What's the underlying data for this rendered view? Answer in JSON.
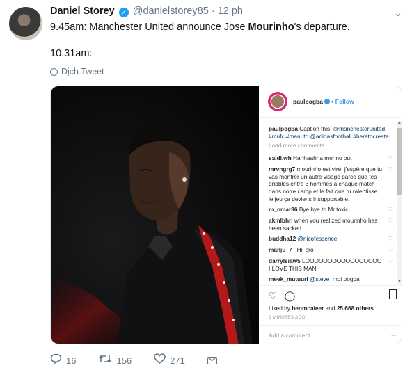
{
  "tweet": {
    "display_name": "Daniel Storey",
    "handle": "@danielstorey85",
    "separator": "·",
    "time": "12 ph",
    "text_line1_a": "9.45am: Manchester United announce Jose ",
    "text_line1_bold": "Mourinho",
    "text_line1_b": "'s departure.",
    "text_line2": "10.31am:",
    "translate_label": "Dịch Tweet"
  },
  "instagram": {
    "username": "paulpogba",
    "dot": "•",
    "follow": "Follow",
    "caption_user": "paulpogba",
    "caption_text": " Caption this!",
    "caption_tags": "@manchesterunited #mufc #manutd @adidasfootball #heretocreate",
    "load_more": "Load more comments",
    "comments": [
      {
        "user": "saidi.wh",
        "text": " Hahhaahha morino out",
        "mention": ""
      },
      {
        "user": "mrvngrg7",
        "text": " mourinho est viré, j'espère que tu vas montrer un autre visage parce que tes dribbles entre 3 hommes à chaque match dans notre camp et le fait que tu ralentisse le jeu ça deviens insupportable.",
        "mention": ""
      },
      {
        "user": "m_omar96",
        "text": " Bye bye to Mr toxic",
        "mention": ""
      },
      {
        "user": "akmlbhri",
        "text": " when you realized mourinho has been sacked",
        "mention": ""
      },
      {
        "user": "buddha12",
        "text": " ",
        "mention": "@nicofessence"
      },
      {
        "user": "manju_7_",
        "text": " Hii bro",
        "mention": ""
      },
      {
        "user": "darrylsiaw5",
        "text": " LOOOOOOOOOOOOOOOOO I LOVE THIS MAN",
        "mention": ""
      },
      {
        "user": "meek_mutuuri",
        "text": " pogba",
        "mention": "@steve_moi"
      }
    ],
    "likes_prefix": "Liked by ",
    "likes_user": "benmcaleer",
    "likes_mid": " and ",
    "likes_count": "25,668 others",
    "time": "2 MINUTES AGO",
    "add_comment": "Add a comment...",
    "more": "···"
  },
  "actions": {
    "reply_count": "16",
    "retweet_count": "156",
    "like_count": "271"
  },
  "icons": {
    "caret": "chevron-down-icon",
    "reply": "reply-icon",
    "retweet": "retweet-icon",
    "like": "heart-icon",
    "dm": "mail-icon"
  },
  "colors": {
    "twitter_blue": "#1da1f2",
    "muted": "#657786",
    "instagram_link": "#3897f0"
  }
}
